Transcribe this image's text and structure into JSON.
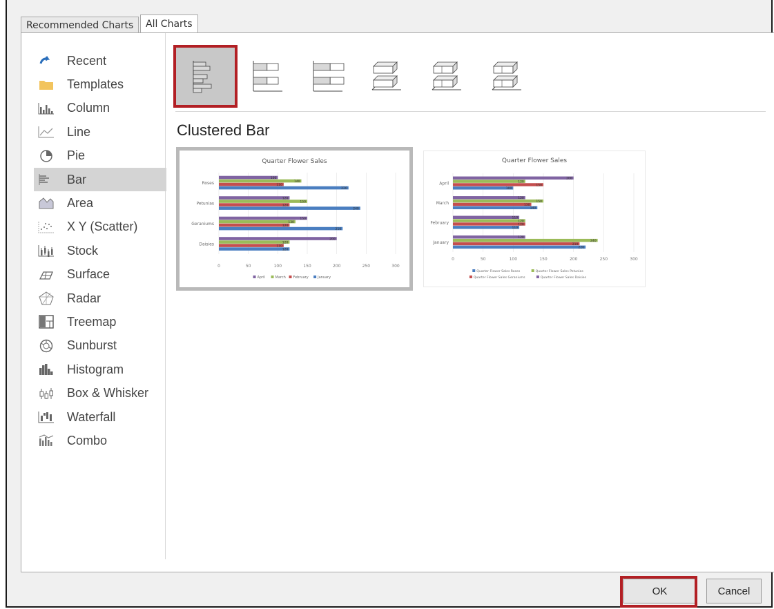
{
  "tabs": [
    {
      "label": "Recommended Charts"
    },
    {
      "label": "All Charts"
    }
  ],
  "sidebar": {
    "items": [
      {
        "label": "Recent",
        "icon": "recent-icon"
      },
      {
        "label": "Templates",
        "icon": "folder-icon"
      },
      {
        "label": "Column",
        "icon": "column-chart-icon"
      },
      {
        "label": "Line",
        "icon": "line-chart-icon"
      },
      {
        "label": "Pie",
        "icon": "pie-chart-icon"
      },
      {
        "label": "Bar",
        "icon": "bar-chart-icon",
        "selected": true
      },
      {
        "label": "Area",
        "icon": "area-chart-icon"
      },
      {
        "label": "X Y (Scatter)",
        "icon": "scatter-chart-icon"
      },
      {
        "label": "Stock",
        "icon": "stock-chart-icon"
      },
      {
        "label": "Surface",
        "icon": "surface-chart-icon"
      },
      {
        "label": "Radar",
        "icon": "radar-chart-icon"
      },
      {
        "label": "Treemap",
        "icon": "treemap-icon"
      },
      {
        "label": "Sunburst",
        "icon": "sunburst-icon"
      },
      {
        "label": "Histogram",
        "icon": "histogram-icon"
      },
      {
        "label": "Box & Whisker",
        "icon": "box-whisker-icon"
      },
      {
        "label": "Waterfall",
        "icon": "waterfall-icon"
      },
      {
        "label": "Combo",
        "icon": "combo-chart-icon"
      }
    ]
  },
  "subtypes": [
    {
      "icon": "clustered-bar-icon",
      "selected": true
    },
    {
      "icon": "stacked-bar-icon"
    },
    {
      "icon": "100-stacked-bar-icon"
    },
    {
      "icon": "3d-clustered-bar-icon"
    },
    {
      "icon": "3d-stacked-bar-icon"
    },
    {
      "icon": "3d-100-stacked-bar-icon"
    }
  ],
  "heading": "Clustered Bar",
  "chart_data": [
    {
      "type": "bar",
      "orientation": "horizontal",
      "title": "Quarter Flower Sales",
      "categories": [
        "Daisies",
        "Geraniums",
        "Petunias",
        "Roses"
      ],
      "series": [
        {
          "name": "January",
          "values": [
            120,
            210,
            240,
            220
          ],
          "color": "#4a7ec0"
        },
        {
          "name": "February",
          "values": [
            110,
            120,
            120,
            110
          ],
          "color": "#c44e4e"
        },
        {
          "name": "March",
          "values": [
            120,
            130,
            150,
            140
          ],
          "color": "#9bbb59"
        },
        {
          "name": "April",
          "values": [
            200,
            150,
            120,
            100
          ],
          "color": "#8064a2"
        }
      ],
      "xlim": [
        0,
        300
      ],
      "xticks": [
        0,
        50,
        100,
        150,
        200,
        250,
        300
      ],
      "legend": "bottom",
      "legend_labels": [
        "April",
        "March",
        "February",
        "January"
      ]
    },
    {
      "type": "bar",
      "orientation": "horizontal",
      "title": "Quarter Flower Sales",
      "categories": [
        "January",
        "February",
        "March",
        "April"
      ],
      "series": [
        {
          "name": "Quarter Flower Sales Roses",
          "values": [
            220,
            110,
            140,
            100
          ],
          "color": "#4a7ec0"
        },
        {
          "name": "Quarter Flower Sales Geraniums",
          "values": [
            210,
            120,
            130,
            150
          ],
          "color": "#c44e4e"
        },
        {
          "name": "Quarter Flower Sales Petunias",
          "values": [
            240,
            120,
            150,
            120
          ],
          "color": "#9bbb59"
        },
        {
          "name": "Quarter Flower Sales Daisies",
          "values": [
            120,
            110,
            120,
            200
          ],
          "color": "#8064a2"
        }
      ],
      "xlim": [
        0,
        300
      ],
      "xticks": [
        0,
        50,
        100,
        150,
        200,
        250,
        300
      ],
      "legend": "bottom",
      "legend_labels": [
        "Quarter Flower Sales Roses",
        "Quarter Flower Sales Petunias",
        "Quarter Flower Sales Geraniums",
        "Quarter Flower Sales Daisies"
      ]
    }
  ],
  "buttons": {
    "ok": "OK",
    "cancel": "Cancel"
  },
  "colors": {
    "highlight": "#b21f24",
    "selected_bg": "#d4d4d4"
  }
}
